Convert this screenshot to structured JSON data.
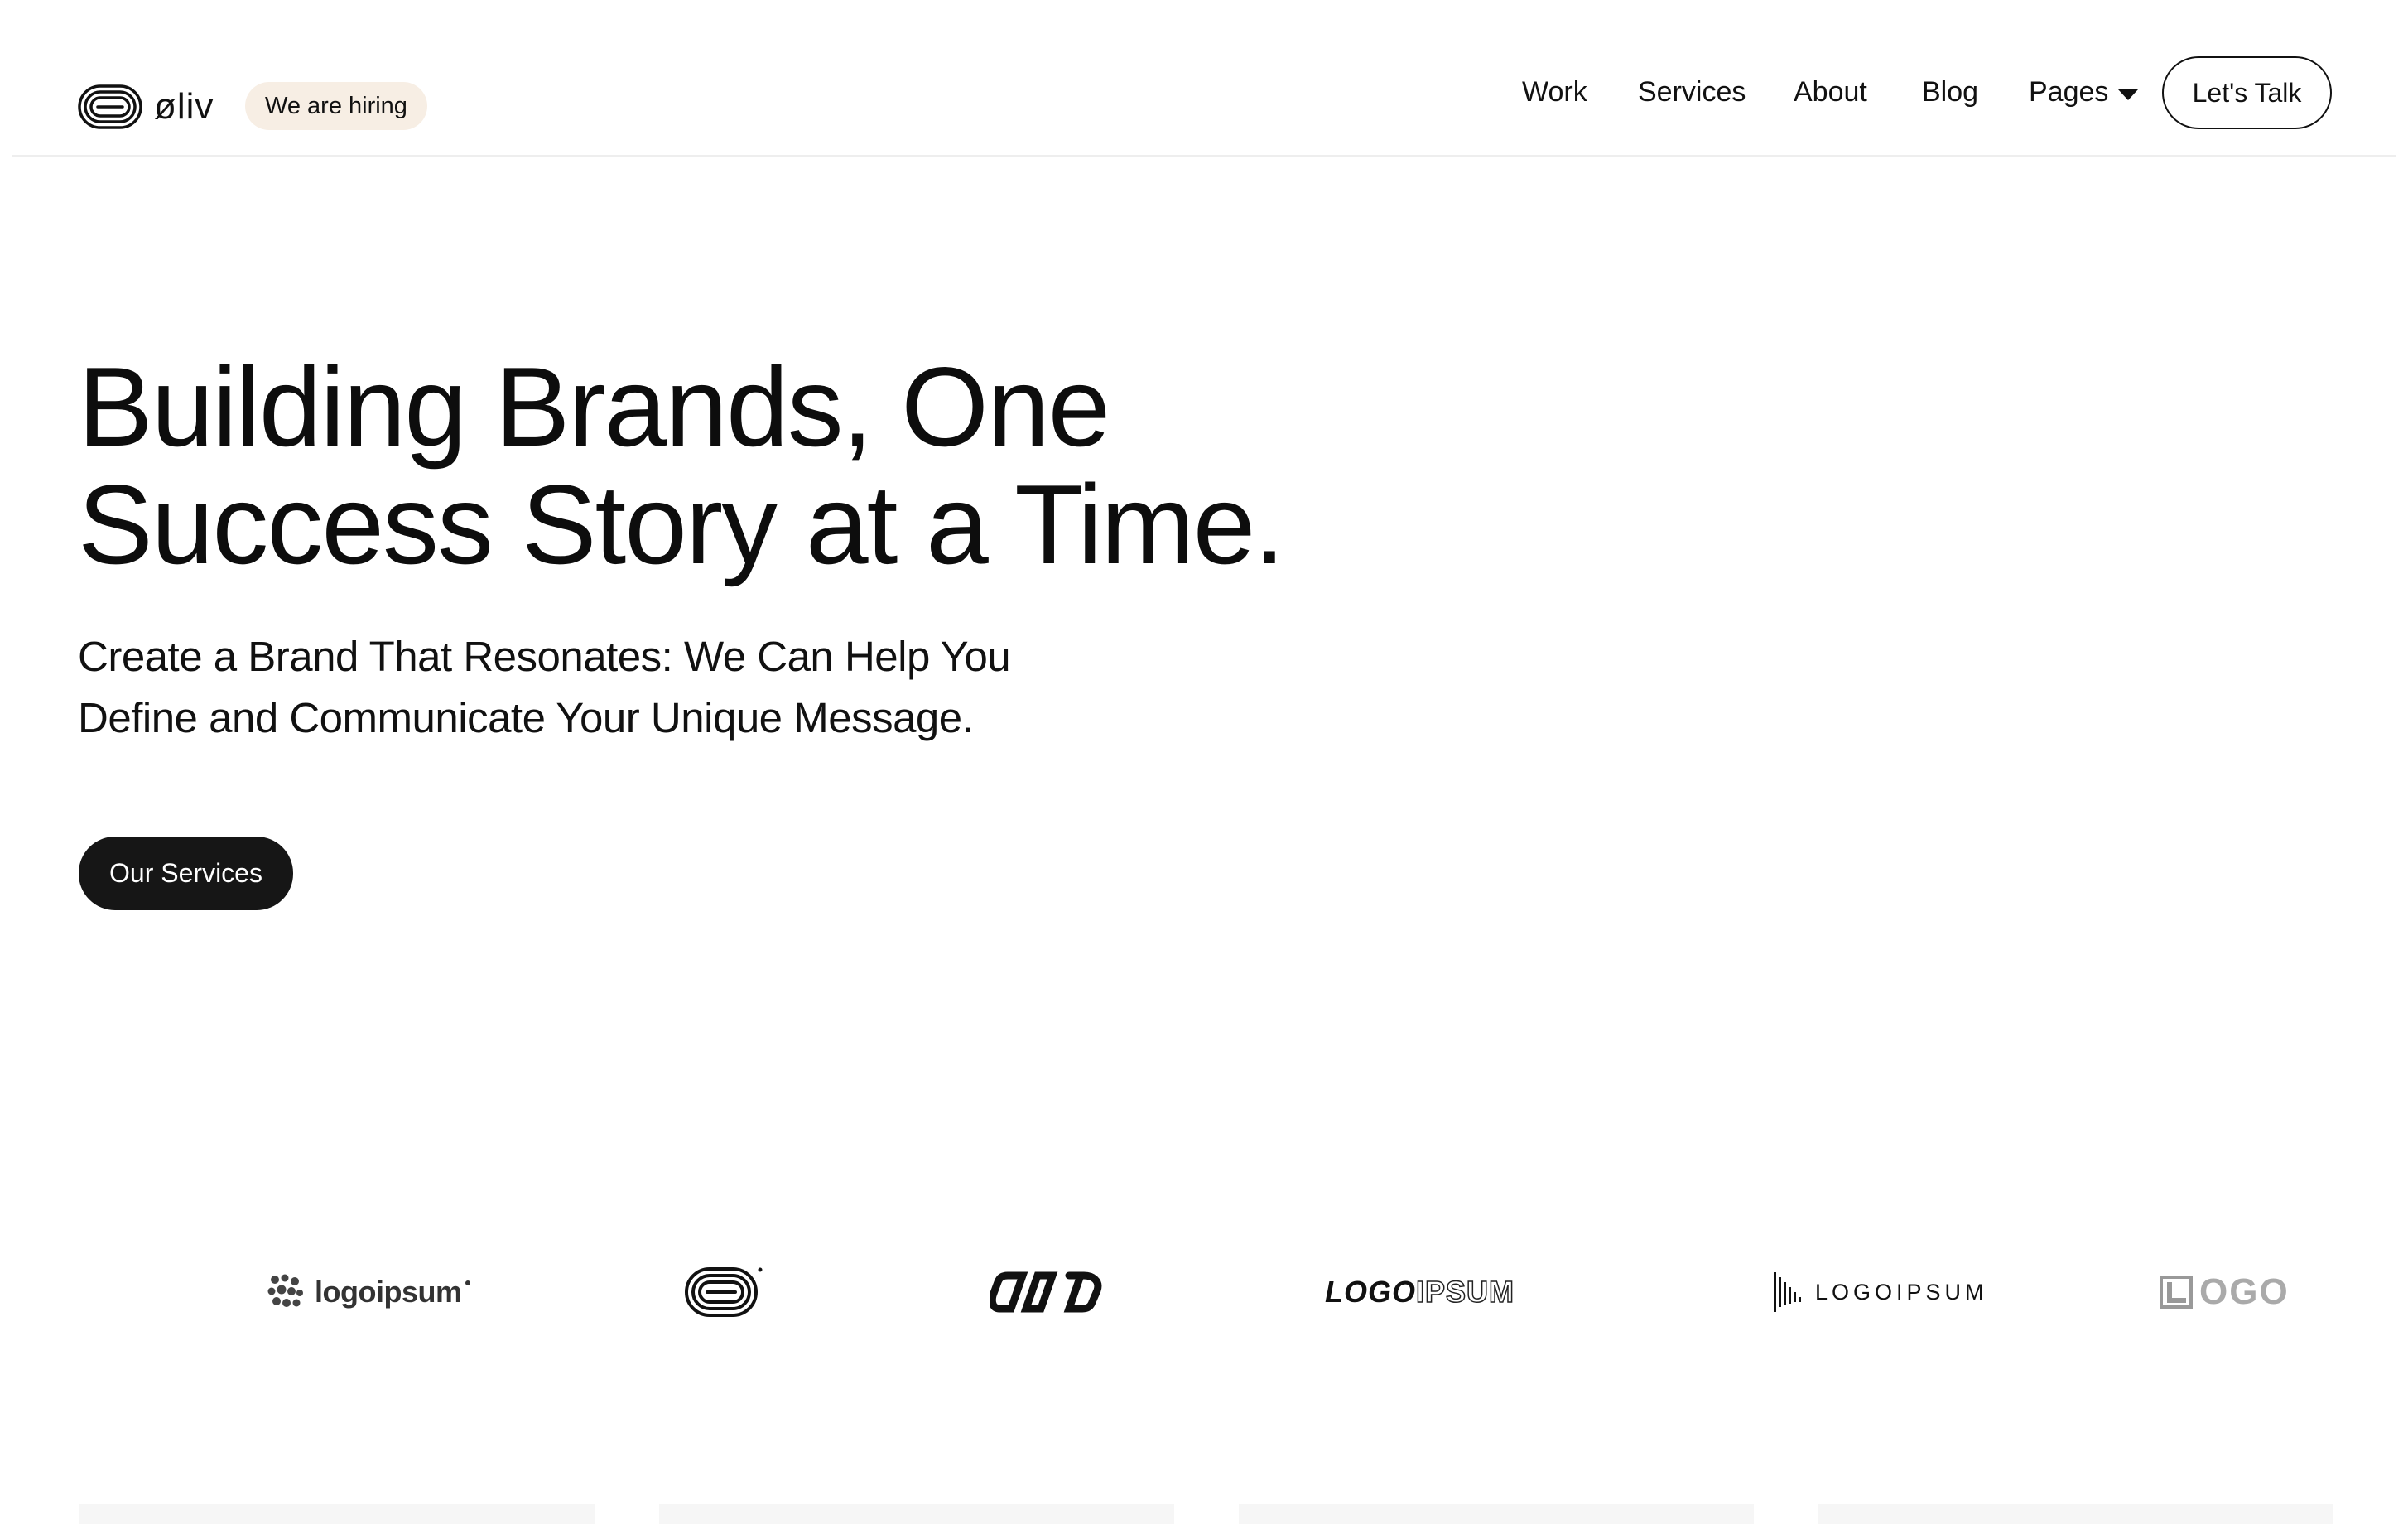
{
  "header": {
    "brand_name": "øliv",
    "hiring_badge": "We are hiring",
    "nav": {
      "work": "Work",
      "services": "Services",
      "about": "About",
      "blog": "Blog",
      "pages": "Pages"
    },
    "cta_label": "Let's Talk"
  },
  "hero": {
    "title_line_1": "Building Brands, One",
    "title_line_2": "Success Story at a Time.",
    "subtitle_line_1": "Create a Brand That Resonates: We Can Help You",
    "subtitle_line_2": "Define and Communicate Your Unique Message.",
    "cta_label": "Our Services"
  },
  "client_logos": {
    "logo_1": "logoipsum",
    "logo_4_a": "LOGO",
    "logo_4_b": "IPSUM",
    "logo_5": "LOGOIPSUM",
    "logo_6": "OGO"
  },
  "icons": {
    "brand": "oliv-loop-mark-icon",
    "pages_caret": "chevron-down-icon",
    "logo_1": "dots-cluster-icon",
    "logo_2": "loop-mark-icon",
    "logo_3": "infinity-links-icon",
    "logo_5": "soundwave-bars-icon",
    "logo_6": "square-l-icon"
  },
  "colors": {
    "text": "#111111",
    "hiring_badge_bg": "#f7eee4",
    "primary_button_bg": "#161616",
    "divider": "#eeeeee"
  }
}
